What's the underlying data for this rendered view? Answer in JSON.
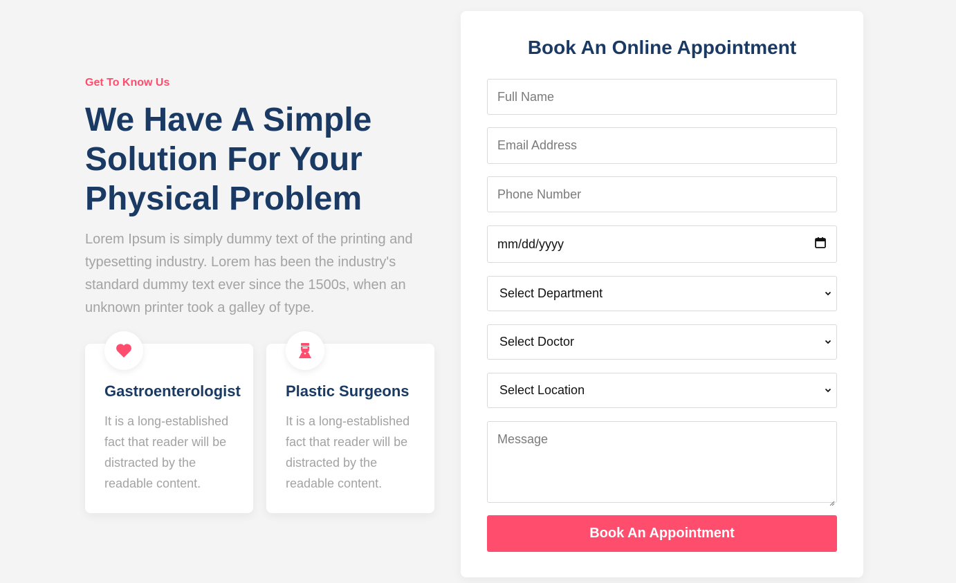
{
  "intro": {
    "eyebrow": "Get To Know Us",
    "headline": "We Have A Simple Solution For Your Physical Problem",
    "paragraph": "Lorem Ipsum is simply dummy text of the printing and typesetting industry. Lorem has been the industry's standard dummy text ever since the 1500s, when an unknown printer took a galley of type."
  },
  "cards": [
    {
      "icon": "heart-icon",
      "title": "Gastroenterologist",
      "text": "It is a long-established fact that reader will be distracted by the readable content."
    },
    {
      "icon": "surgeon-icon",
      "title": "Plastic Surgeons",
      "text": "It is a long-established fact that reader will be distracted by the readable content."
    }
  ],
  "form": {
    "title": "Book An Online Appointment",
    "full_name_placeholder": "Full Name",
    "email_placeholder": "Email Address",
    "phone_placeholder": "Phone Number",
    "date_placeholder": "mm/dd/yyyy",
    "department_selected": "Select Department",
    "doctor_selected": "Select Doctor",
    "location_selected": "Select Location",
    "message_placeholder": "Message",
    "submit_label": "Book An Appointment"
  },
  "colors": {
    "accent": "#ff4d6d",
    "heading": "#1a3a64",
    "muted_text": "#a3a3a3",
    "background": "#f4f4f4"
  }
}
